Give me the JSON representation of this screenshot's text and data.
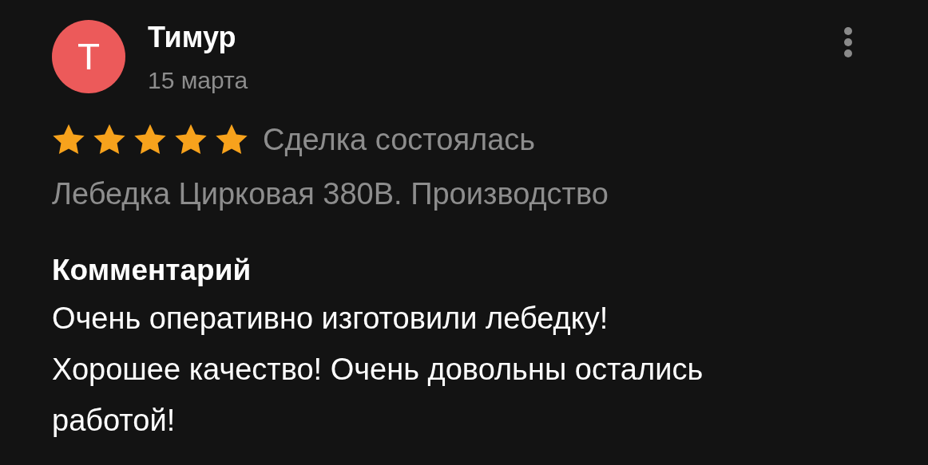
{
  "review": {
    "avatar": {
      "letter": "Т",
      "color": "#ec5a5a"
    },
    "author": "Тимур",
    "date": "15 марта",
    "stars": 5,
    "status": "Сделка состоялась",
    "product": "Лебедка Цирковая 380В. Производство",
    "comment_heading": "Комментарий",
    "comment": "Очень оперативно изготовили лебедку!\nХорошее качество! Очень довольны остались\nработой!"
  }
}
